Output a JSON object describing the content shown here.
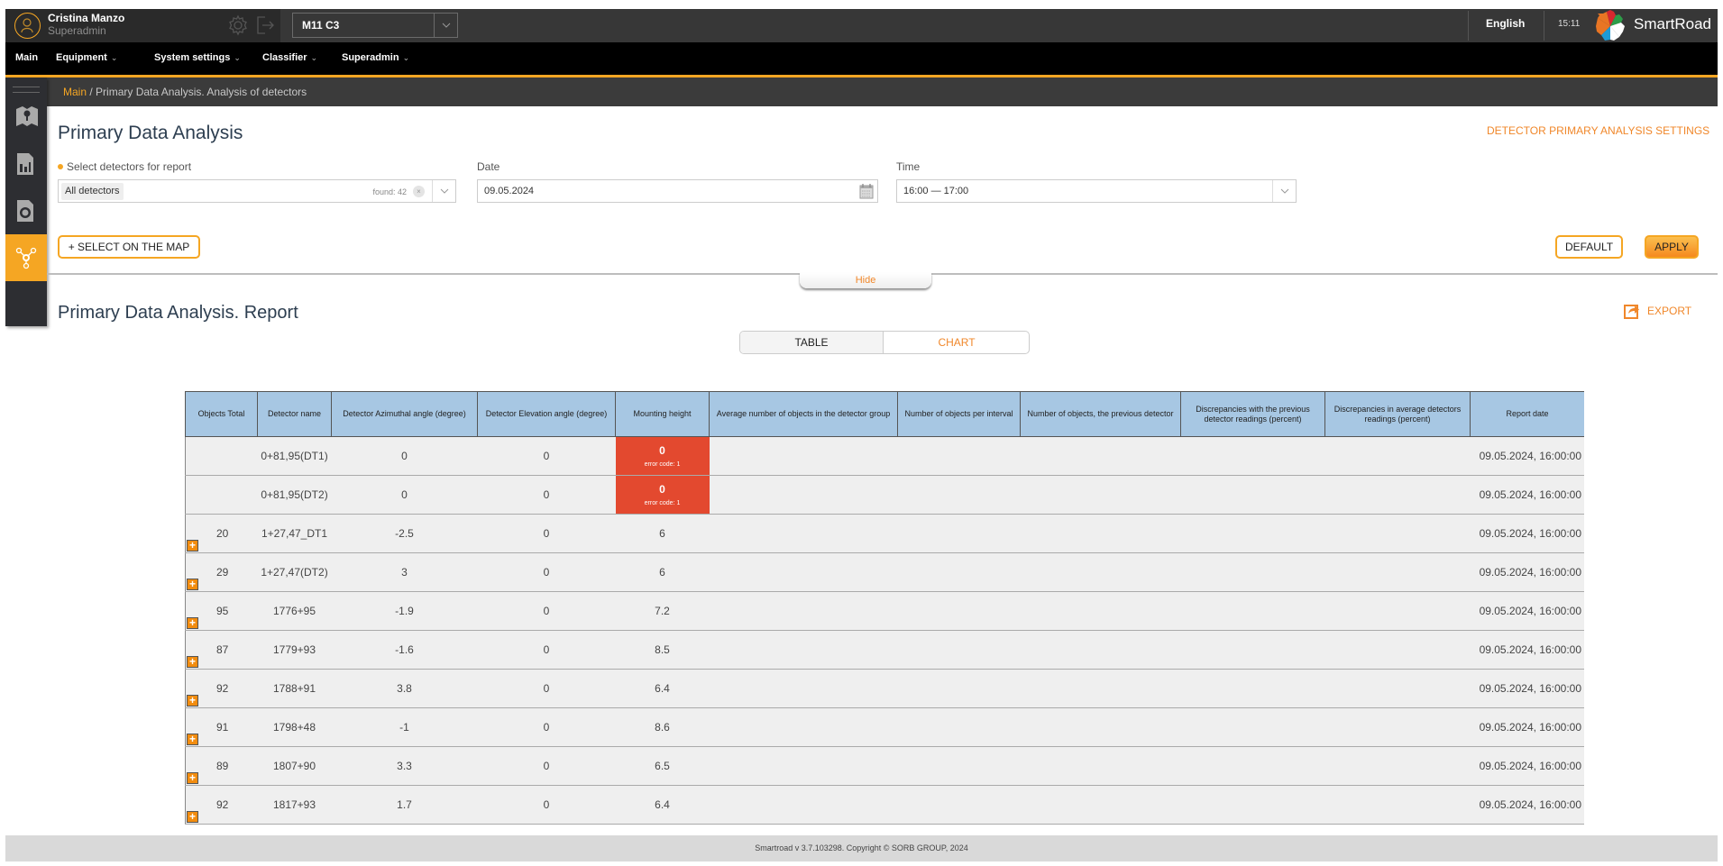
{
  "header": {
    "user_name": "Cristina Manzo",
    "user_role": "Superadmin",
    "project": "M11 C3",
    "language": "English",
    "time": "15:11",
    "brand": "SmartRoad",
    "icons": {
      "avatar": "user-icon",
      "settings": "gear-icon",
      "logout": "logout-icon"
    }
  },
  "nav": {
    "items": [
      {
        "label": "Main",
        "has_dropdown": false
      },
      {
        "label": "Equipment",
        "has_dropdown": true
      },
      {
        "label": "System settings",
        "has_dropdown": true
      },
      {
        "label": "Classifier",
        "has_dropdown": true
      },
      {
        "label": "Superadmin",
        "has_dropdown": true
      }
    ],
    "chevron": "⌄"
  },
  "sidebar": {
    "items": [
      {
        "icon": "map-icon",
        "active": false
      },
      {
        "icon": "report-chart-icon",
        "active": false
      },
      {
        "icon": "detector-camera-icon",
        "active": false
      },
      {
        "icon": "network-nodes-icon",
        "active": true
      }
    ]
  },
  "breadcrumb": {
    "root": "Main",
    "separator": " / ",
    "current": "Primary Data Analysis. Analysis of detectors"
  },
  "filters": {
    "title": "Primary Data Analysis",
    "settings_link": "DETECTOR PRIMARY ANALYSIS SETTINGS",
    "detectors_label": "Select detectors for report",
    "detectors_chip": "All detectors",
    "detectors_found": "found: 42",
    "clear_symbol": "×",
    "date_label": "Date",
    "date_value": "09.05.2024",
    "time_label": "Time",
    "time_value": "16:00 — 17:00",
    "select_on_map": "+ SELECT ON THE MAP",
    "default_btn": "DEFAULT",
    "apply_btn": "APPLY",
    "hide": "Hide"
  },
  "report": {
    "title": "Primary Data Analysis. Report",
    "export": "EXPORT",
    "view_options": [
      "TABLE",
      "CHART"
    ],
    "active_view": "TABLE",
    "columns": [
      "Objects Total",
      "Detector name",
      "Detector Azimuthal angle (degree)",
      "Detector Elevation angle (degree)",
      "Mounting height",
      "Average number of objects in the detector group",
      "Number of objects per interval",
      "Number of objects, the previous detector",
      "Discrepancies with the previous detector readings (percent)",
      "Discrepancies in average detectors readings (percent)",
      "Report date"
    ],
    "rows": [
      {
        "objects_total": "",
        "name": "0+81,95(DT1)",
        "azimuth": "0",
        "elevation": "0",
        "height": "0",
        "height_error": "error code: 1",
        "avg_group": "",
        "per_interval": "",
        "prev_detector": "",
        "disc_prev": "",
        "disc_avg": "",
        "date": "09.05.2024, 16:00:00",
        "expandable": false
      },
      {
        "objects_total": "",
        "name": "0+81,95(DT2)",
        "azimuth": "0",
        "elevation": "0",
        "height": "0",
        "height_error": "error code: 1",
        "avg_group": "",
        "per_interval": "",
        "prev_detector": "",
        "disc_prev": "",
        "disc_avg": "",
        "date": "09.05.2024, 16:00:00",
        "expandable": false
      },
      {
        "objects_total": "20",
        "name": "1+27,47_DT1",
        "azimuth": "-2.5",
        "elevation": "0",
        "height": "6",
        "height_error": "",
        "avg_group": "",
        "per_interval": "",
        "prev_detector": "",
        "disc_prev": "",
        "disc_avg": "",
        "date": "09.05.2024, 16:00:00",
        "expandable": true
      },
      {
        "objects_total": "29",
        "name": "1+27,47(DT2)",
        "azimuth": "3",
        "elevation": "0",
        "height": "6",
        "height_error": "",
        "avg_group": "",
        "per_interval": "",
        "prev_detector": "",
        "disc_prev": "",
        "disc_avg": "",
        "date": "09.05.2024, 16:00:00",
        "expandable": true
      },
      {
        "objects_total": "95",
        "name": "1776+95",
        "azimuth": "-1.9",
        "elevation": "0",
        "height": "7.2",
        "height_error": "",
        "avg_group": "",
        "per_interval": "",
        "prev_detector": "",
        "disc_prev": "",
        "disc_avg": "",
        "date": "09.05.2024, 16:00:00",
        "expandable": true
      },
      {
        "objects_total": "87",
        "name": "1779+93",
        "azimuth": "-1.6",
        "elevation": "0",
        "height": "8.5",
        "height_error": "",
        "avg_group": "",
        "per_interval": "",
        "prev_detector": "",
        "disc_prev": "",
        "disc_avg": "",
        "date": "09.05.2024, 16:00:00",
        "expandable": true
      },
      {
        "objects_total": "92",
        "name": "1788+91",
        "azimuth": "3.8",
        "elevation": "0",
        "height": "6.4",
        "height_error": "",
        "avg_group": "",
        "per_interval": "",
        "prev_detector": "",
        "disc_prev": "",
        "disc_avg": "",
        "date": "09.05.2024, 16:00:00",
        "expandable": true
      },
      {
        "objects_total": "91",
        "name": "1798+48",
        "azimuth": "-1",
        "elevation": "0",
        "height": "8.6",
        "height_error": "",
        "avg_group": "",
        "per_interval": "",
        "prev_detector": "",
        "disc_prev": "",
        "disc_avg": "",
        "date": "09.05.2024, 16:00:00",
        "expandable": true
      },
      {
        "objects_total": "89",
        "name": "1807+90",
        "azimuth": "3.3",
        "elevation": "0",
        "height": "6.5",
        "height_error": "",
        "avg_group": "",
        "per_interval": "",
        "prev_detector": "",
        "disc_prev": "",
        "disc_avg": "",
        "date": "09.05.2024, 16:00:00",
        "expandable": true
      },
      {
        "objects_total": "92",
        "name": "1817+93",
        "azimuth": "1.7",
        "elevation": "0",
        "height": "6.4",
        "height_error": "",
        "avg_group": "",
        "per_interval": "",
        "prev_detector": "",
        "disc_prev": "",
        "disc_avg": "",
        "date": "09.05.2024, 16:00:00",
        "expandable": true
      }
    ],
    "expand_symbol": "+"
  },
  "footer": {
    "text": "Smartroad v 3.7.103298. Copyright © SORB GROUP, 2024"
  },
  "colors": {
    "accent": "#f5a623",
    "link_orange": "#f0872a",
    "error_red": "#e3492f",
    "table_header": "#a7c7e3"
  }
}
